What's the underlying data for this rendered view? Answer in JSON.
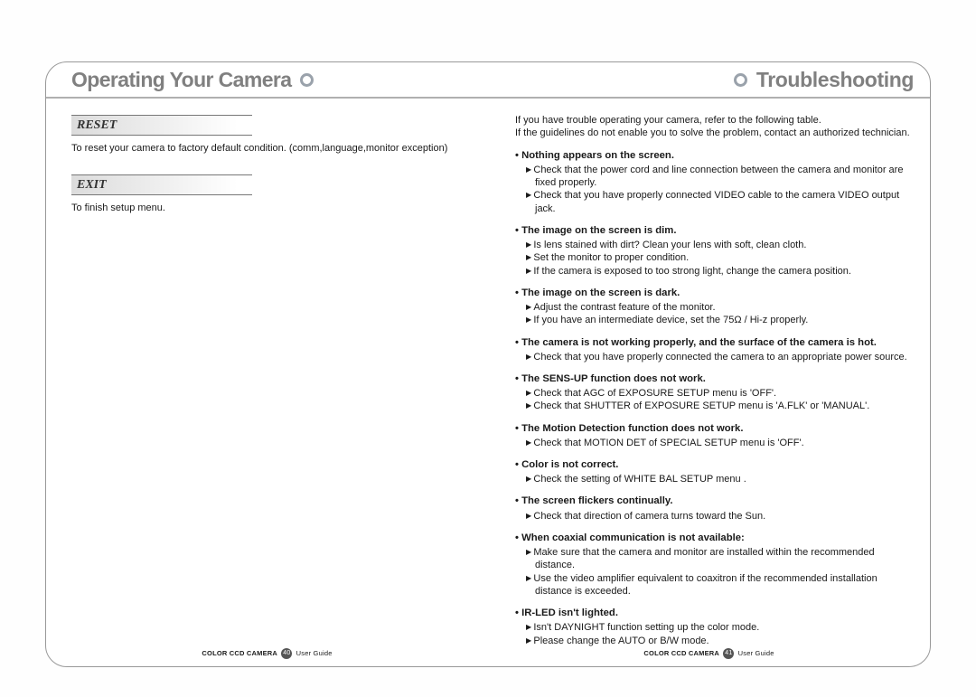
{
  "header": {
    "left": "Operating Your Camera",
    "right": "Troubleshooting"
  },
  "left_page": {
    "sections": [
      {
        "title": "RESET",
        "body": "To reset your camera to factory default condition. (comm,language,monitor exception)"
      },
      {
        "title": "EXIT",
        "body": "To finish setup menu."
      }
    ],
    "footer_product": "COLOR CCD CAMERA",
    "footer_page": "40",
    "footer_label": "User Guide"
  },
  "right_page": {
    "intro1": "If you have trouble operating your camera, refer to the following table.",
    "intro2": "If the guidelines do not enable you to solve the problem, contact an authorized technician.",
    "issues": [
      {
        "title": "Nothing appears on the screen.",
        "steps": [
          "Check that the power cord and line connection between the camera and monitor are fixed properly.",
          "Check that you have properly connected VIDEO cable to the camera VIDEO output jack."
        ]
      },
      {
        "title": "The image on the screen is dim.",
        "steps": [
          "Is lens stained with dirt? Clean your lens with soft, clean cloth.",
          "Set the monitor to proper condition.",
          "If the camera is exposed to too strong light, change the camera position."
        ]
      },
      {
        "title": "The image on the screen is dark.",
        "steps": [
          "Adjust the contrast feature of the monitor.",
          "If you have an intermediate device, set the 75Ω / Hi-z properly."
        ]
      },
      {
        "title": "The camera is not working properly, and the surface of the camera is hot.",
        "steps": [
          "Check that you have properly connected the camera to an appropriate power source."
        ]
      },
      {
        "title": "The SENS-UP function does not work.",
        "steps": [
          "Check that AGC of EXPOSURE SETUP menu is 'OFF'.",
          "Check that SHUTTER of EXPOSURE SETUP menu is 'A.FLK' or 'MANUAL'."
        ]
      },
      {
        "title": "The Motion Detection function does not work.",
        "steps": [
          "Check that MOTION DET of SPECIAL SETUP menu is 'OFF'."
        ]
      },
      {
        "title": "Color is not correct.",
        "steps": [
          "Check the setting of WHITE BAL SETUP menu ."
        ]
      },
      {
        "title": "The screen flickers continually.",
        "steps": [
          "Check that direction of camera turns toward the Sun."
        ]
      },
      {
        "title": "When coaxial communication is not available:",
        "steps": [
          "Make sure that the camera and monitor are installed within the recommended distance.",
          "Use the video amplifier equivalent to coaxitron if the recommended installation distance is exceeded."
        ]
      },
      {
        "title": "IR-LED isn't lighted.",
        "steps": [
          "Isn't DAYNIGHT function setting up the color mode.",
          "Please change the AUTO or B/W mode."
        ]
      }
    ],
    "footer_product": "COLOR CCD CAMERA",
    "footer_page": "41",
    "footer_label": "User Guide"
  }
}
